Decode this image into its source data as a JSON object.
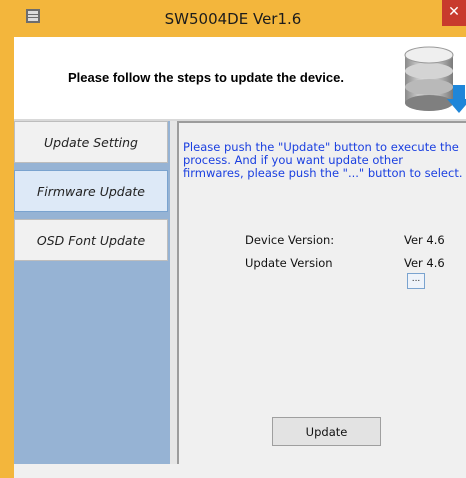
{
  "window": {
    "title": "SW5004DE Ver1.6",
    "close_label": "✕",
    "accent": "#f3b63c"
  },
  "header": {
    "instruction": "Please follow the steps to update the device.",
    "icon": "database-download-icon"
  },
  "sidebar": {
    "items": [
      {
        "label": "Update Setting",
        "active": false
      },
      {
        "label": "Firmware Update",
        "active": true
      },
      {
        "label": "OSD Font Update",
        "active": false
      }
    ]
  },
  "main": {
    "instructions": "Please push the \"Update\" button to execute the process. And if you want update other firmwares, please push the \"...\" button to select.",
    "device_version_label": "Device Version:",
    "device_version_value": "Ver 4.6",
    "update_version_label": "Update Version",
    "update_version_value": "Ver 4.6",
    "browse_label": "...",
    "update_button": "Update"
  }
}
